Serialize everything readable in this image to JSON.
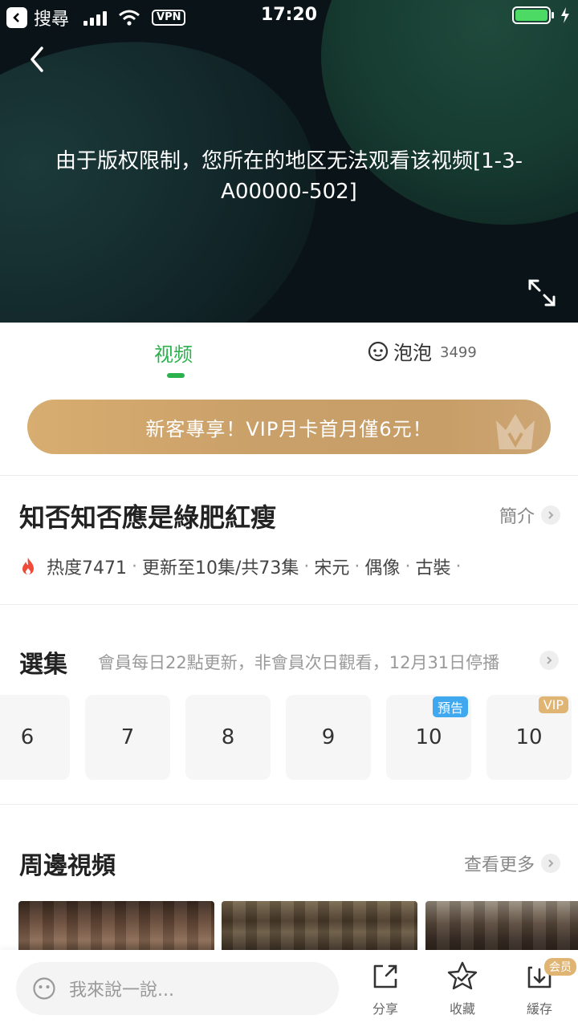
{
  "status_bar": {
    "back_app": "搜尋",
    "network": "VPN",
    "time": "17:20"
  },
  "player": {
    "message": "由于版权限制，您所在的地区无法观看该视频[1-3-A00000-502]"
  },
  "tabs": {
    "video": "视频",
    "bubble": "泡泡",
    "bubble_count": "3499"
  },
  "promo": {
    "text": "新客專享！VIP月卡首月僅6元！"
  },
  "show": {
    "title": "知否知否應是綠肥紅瘦",
    "intro_label": "簡介",
    "meta": [
      "热度7471",
      "更新至10集/共73集",
      "宋元",
      "偶像",
      "古裝"
    ],
    "meta_separator": "·"
  },
  "episodes": {
    "heading": "選集",
    "note": "會員每日22點更新，非會員次日觀看，12月31日停播",
    "items": [
      {
        "label": "6",
        "badge": ""
      },
      {
        "label": "7",
        "badge": ""
      },
      {
        "label": "8",
        "badge": ""
      },
      {
        "label": "9",
        "badge": ""
      },
      {
        "label": "10",
        "badge": "預告"
      },
      {
        "label": "10",
        "badge": "VIP"
      }
    ]
  },
  "nearby": {
    "heading": "周邊視頻",
    "more_label": "查看更多"
  },
  "bottom_bar": {
    "comment_placeholder": "我來說一說...",
    "share_label": "分享",
    "favorite_label": "收藏",
    "cache_label": "緩存",
    "member_badge": "会员"
  },
  "colors": {
    "accent_green": "#2bb24c",
    "promo_gold": "#c89e68",
    "preview_blue": "#3fa8ef"
  }
}
